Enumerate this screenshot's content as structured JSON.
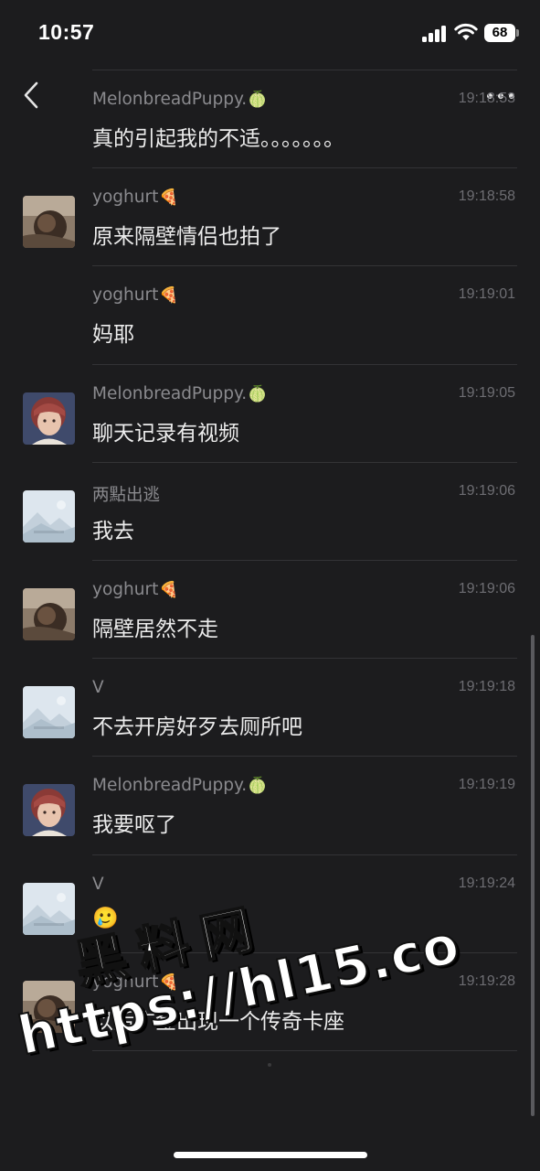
{
  "status_bar": {
    "time": "10:57",
    "battery": "68"
  },
  "header": {
    "back_icon": "chevron-left-icon",
    "more_icon": "ellipsis-icon"
  },
  "messages": [
    {
      "sender": "MelonbreadPuppy.",
      "sender_emoji": "🍈",
      "time": "19:18:53",
      "text": "真的引起我的不适。。。。。。。",
      "avatar": ""
    },
    {
      "sender": "yoghurt",
      "sender_emoji": "🍕",
      "time": "19:18:58",
      "text": "原来隔壁情侣也拍了",
      "avatar": "yoghurt"
    },
    {
      "sender": "yoghurt",
      "sender_emoji": "🍕",
      "time": "19:19:01",
      "text": "妈耶",
      "avatar": ""
    },
    {
      "sender": "MelonbreadPuppy.",
      "sender_emoji": "🍈",
      "time": "19:19:05",
      "text": "聊天记录有视频",
      "avatar": "melon"
    },
    {
      "sender": "两點出逃",
      "sender_emoji": "",
      "time": "19:19:06",
      "text": "我去",
      "avatar": "placeholder"
    },
    {
      "sender": "yoghurt",
      "sender_emoji": "🍕",
      "time": "19:19:06",
      "text": "隔壁居然不走",
      "avatar": "yoghurt"
    },
    {
      "sender": "V",
      "sender_emoji": "",
      "time": "19:19:18",
      "text": "不去开房好歹去厕所吧",
      "avatar": "placeholder"
    },
    {
      "sender": "MelonbreadPuppy.",
      "sender_emoji": "🍈",
      "time": "19:19:19",
      "text": "我要呕了",
      "avatar": "melon"
    },
    {
      "sender": "V",
      "sender_emoji": "",
      "time": "19:19:24",
      "text": "🥲",
      "avatar": "placeholder"
    },
    {
      "sender": "yoghurt",
      "sender_emoji": "🍕",
      "time": "19:19:28",
      "text": "以后广金出现一个传奇卡座",
      "avatar": "yoghurt"
    }
  ],
  "watermark": {
    "title": "黑料网",
    "url": "https://hl15.co"
  },
  "colors": {
    "background": "#1c1c1e",
    "sender_text": "#8a8a8e",
    "message_text": "#ececec",
    "timestamp": "#6d6d72",
    "divider": "#333336"
  }
}
